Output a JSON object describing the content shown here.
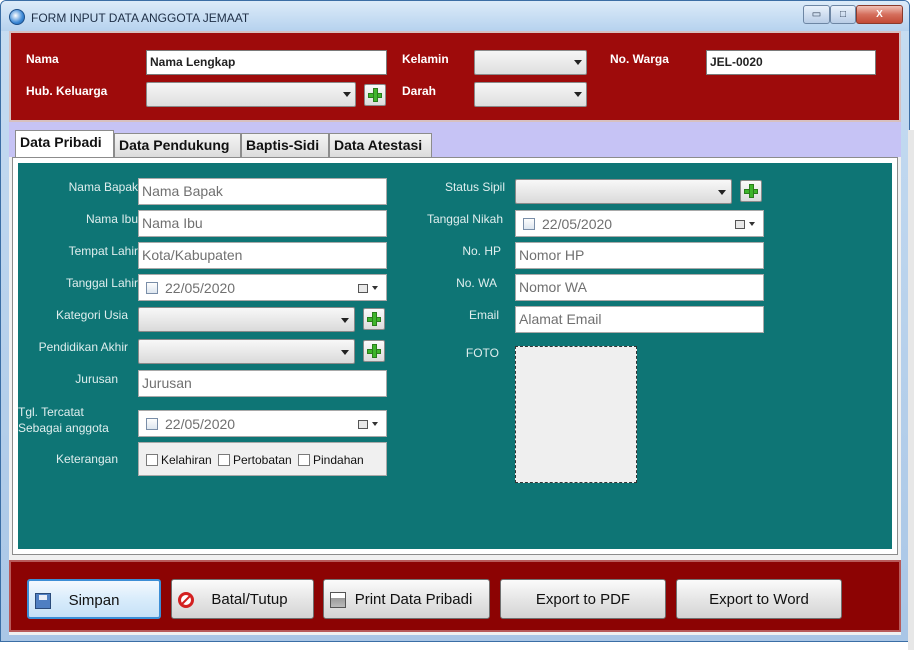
{
  "window": {
    "title": "FORM INPUT DATA ANGGOTA JEMAAT",
    "controls": {
      "minimize": "▭",
      "maximize": "□",
      "close": "X"
    }
  },
  "header": {
    "nama_label": "Nama",
    "nama_value": "Nama Lengkap",
    "hub_label": "Hub. Keluarga",
    "hub_value": "",
    "kelamin_label": "Kelamin",
    "kelamin_value": "",
    "darah_label": "Darah",
    "darah_value": "",
    "nowarga_label": "No. Warga",
    "nowarga_value": "JEL-0020"
  },
  "tabs": [
    {
      "label": "Data Pribadi",
      "active": true
    },
    {
      "label": "Data Pendukung",
      "active": false
    },
    {
      "label": "Baptis-Sidi",
      "active": false
    },
    {
      "label": "Data Atestasi",
      "active": false
    }
  ],
  "pribadi": {
    "nama_bapak": {
      "label": "Nama Bapak",
      "placeholder": "Nama Bapak"
    },
    "nama_ibu": {
      "label": "Nama Ibu",
      "placeholder": "Nama Ibu"
    },
    "tempat_lahir": {
      "label": "Tempat Lahir",
      "placeholder": "Kota/Kabupaten"
    },
    "tanggal_lahir": {
      "label": "Tanggal Lahir",
      "value": "22/05/2020"
    },
    "kategori_usia": {
      "label": "Kategori Usia",
      "value": ""
    },
    "pendidikan_akhir": {
      "label": "Pendidikan Akhir",
      "value": ""
    },
    "jurusan": {
      "label": "Jurusan",
      "placeholder": "Jurusan"
    },
    "tgl_tercatat": {
      "label_line1": "Tgl. Tercatat",
      "label_line2": "Sebagai anggota",
      "value": "22/05/2020"
    },
    "keterangan": {
      "label": "Keterangan",
      "options": [
        "Kelahiran",
        "Pertobatan",
        "Pindahan"
      ]
    },
    "status_sipil": {
      "label": "Status Sipil",
      "value": ""
    },
    "tanggal_nikah": {
      "label": "Tanggal Nikah",
      "value": "22/05/2020"
    },
    "no_hp": {
      "label": "No. HP",
      "placeholder": "Nomor HP"
    },
    "no_wa": {
      "label": "No. WA",
      "placeholder": "Nomor  WA"
    },
    "email": {
      "label": "Email",
      "placeholder": "Alamat Email"
    },
    "foto": {
      "label": "FOTO"
    }
  },
  "footer": {
    "simpan": "Simpan",
    "batal": "Batal/Tutup",
    "print": "Print Data Pribadi",
    "pdf": "Export to PDF",
    "word": "Export to Word"
  },
  "colors": {
    "header_bg": "#9e0b0b",
    "tab_band": "#c6c3f5",
    "panel_teal": "#0e7575",
    "footer_bg": "#8c0303"
  },
  "icons": [
    "app-icon",
    "add-icon",
    "calendar-icon",
    "save-icon",
    "cancel-icon",
    "printer-icon"
  ]
}
